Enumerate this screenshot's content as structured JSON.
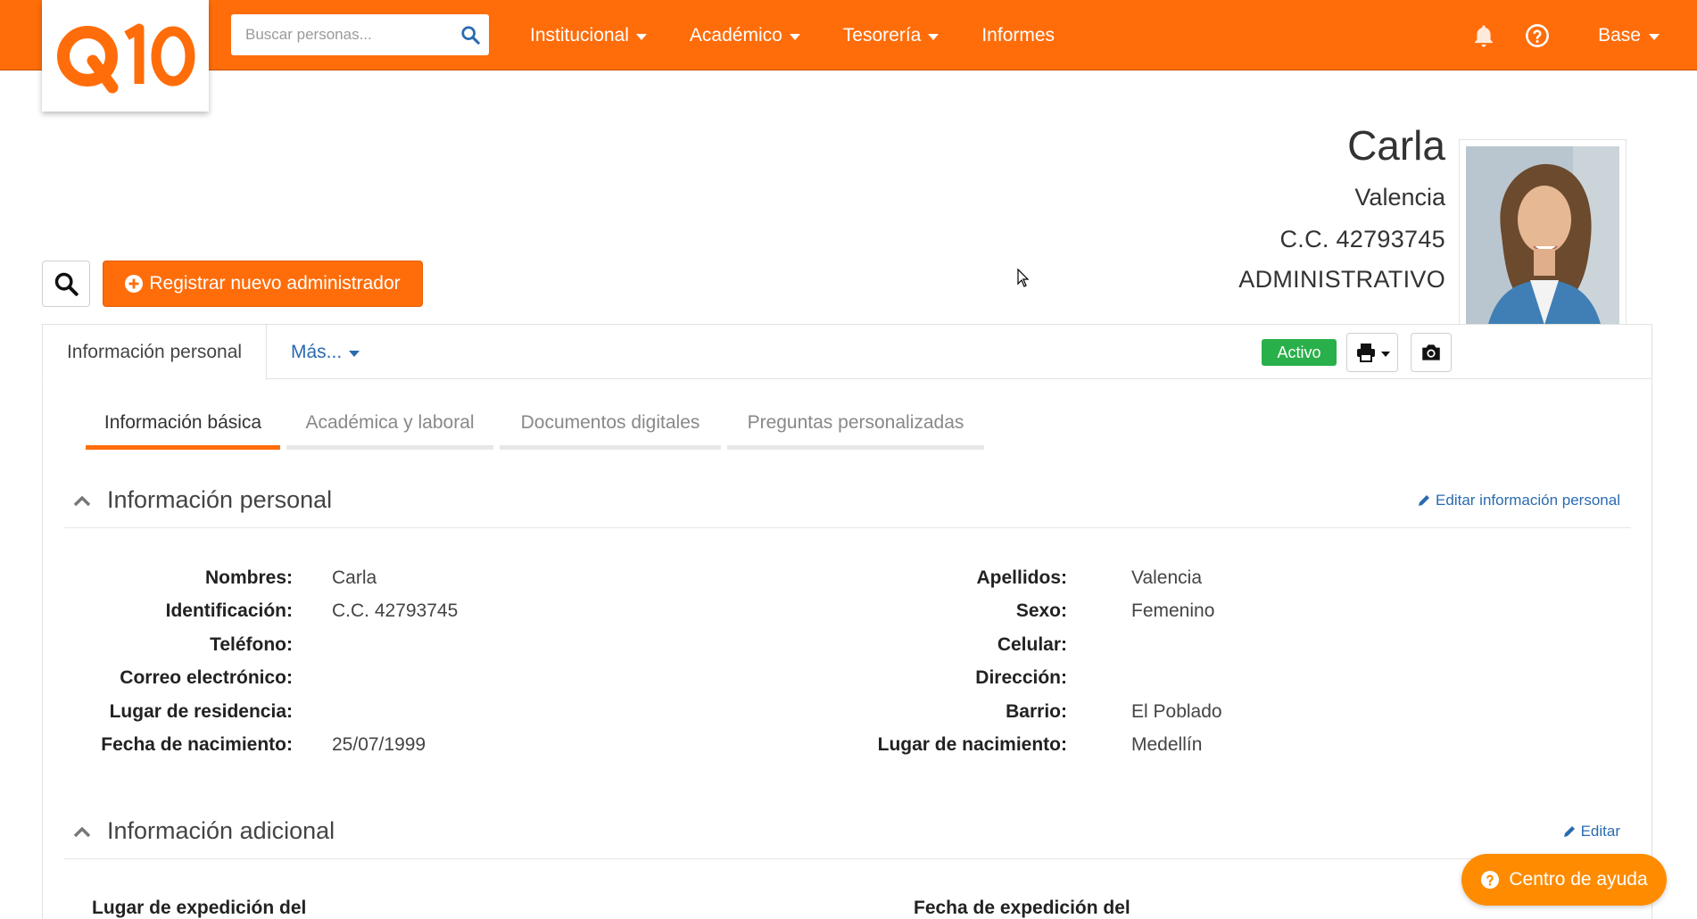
{
  "brand": {
    "logo_text": "Q10",
    "accent": "#ff6d0a"
  },
  "topbar": {
    "search_placeholder": "Buscar personas...",
    "nav": [
      {
        "label": "Institucional",
        "dropdown": true
      },
      {
        "label": "Académico",
        "dropdown": true
      },
      {
        "label": "Tesorería",
        "dropdown": true
      },
      {
        "label": "Informes",
        "dropdown": false
      }
    ],
    "icons": [
      "bell-icon",
      "help-circle-icon"
    ],
    "user_menu": "Base"
  },
  "profile": {
    "first_name": "Carla",
    "last_name": "Valencia",
    "id_doc": "C.C. 42793745",
    "role": "ADMINISTRATIVO"
  },
  "actions": {
    "register_label": "Registrar nuevo administrador"
  },
  "panel": {
    "tab_active": "Información personal",
    "tab_more": "Más...",
    "status": "Activo",
    "status_color": "#2ab04a",
    "subtabs": [
      "Información básica",
      "Académica y laboral",
      "Documentos digitales",
      "Preguntas personalizadas"
    ],
    "active_subtab": 0
  },
  "personal": {
    "title": "Información personal",
    "edit_label": "Editar información personal",
    "left": [
      {
        "label": "Nombres:",
        "value": "Carla"
      },
      {
        "label": "Identificación:",
        "value": "C.C. 42793745"
      },
      {
        "label": "Teléfono:",
        "value": ""
      },
      {
        "label": "Correo electrónico:",
        "value": ""
      },
      {
        "label": "Lugar de residencia:",
        "value": ""
      },
      {
        "label": "Fecha de nacimiento:",
        "value": "25/07/1999"
      }
    ],
    "right": [
      {
        "label": "Apellidos:",
        "value": "Valencia"
      },
      {
        "label": "Sexo:",
        "value": "Femenino"
      },
      {
        "label": "Celular:",
        "value": ""
      },
      {
        "label": "Dirección:",
        "value": ""
      },
      {
        "label": "Barrio:",
        "value": "El Poblado"
      },
      {
        "label": "Lugar de nacimiento:",
        "value": "Medellín"
      }
    ]
  },
  "additional": {
    "title": "Información adicional",
    "edit_label": "Editar",
    "left_label": "Lugar de expedición del",
    "right_label": "Fecha de expedición del"
  },
  "help": {
    "label": "Centro de ayuda"
  }
}
